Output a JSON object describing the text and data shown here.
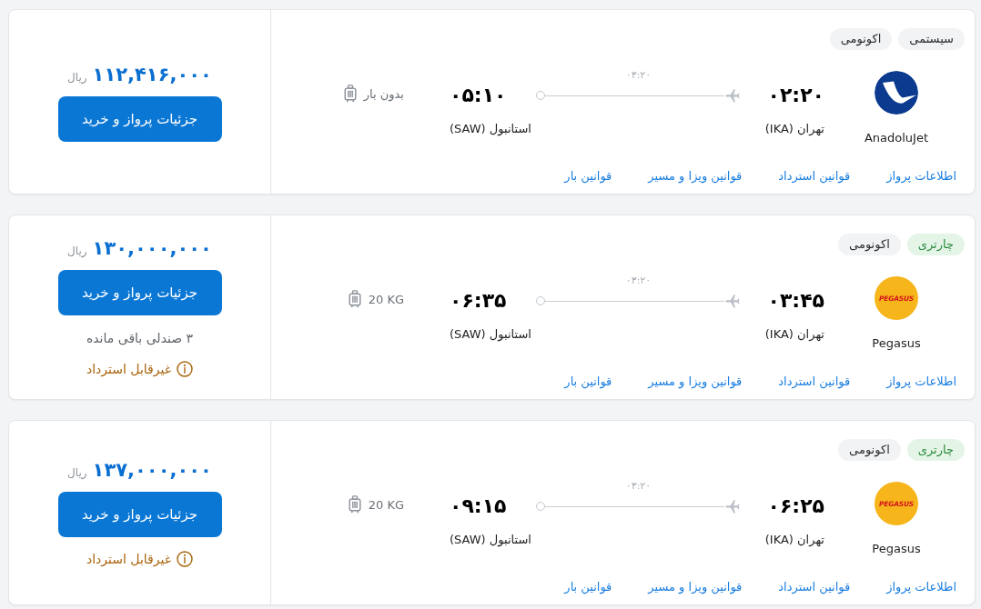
{
  "flights": [
    {
      "tags": [
        {
          "kind": "system",
          "label": "سیستمی"
        },
        {
          "kind": "class",
          "label": "اکونومی"
        }
      ],
      "airline": {
        "logo": {
          "kind": "swoosh"
        },
        "name": "AnadoluJet"
      },
      "departure": {
        "time": "۰۲:۲۰",
        "airport": "تهران (IKA)"
      },
      "duration": "۰۳:۲۰",
      "arrival": {
        "time": "۰۵:۱۰",
        "airport": "استانبول (SAW)"
      },
      "baggage": "بدون بار",
      "links": [
        "اطلاعات پرواز",
        "قوانین استرداد",
        "قوانین ویزا و مسیر",
        "قوانین بار"
      ],
      "price": {
        "amount": "۱۱۲,۴۱۶,۰۰۰",
        "currency": "ریال"
      },
      "button": "جزئیات پرواز و خرید"
    },
    {
      "tags": [
        {
          "kind": "charter",
          "label": "چارتری"
        },
        {
          "kind": "class",
          "label": "اکونومی"
        }
      ],
      "airline": {
        "logo": {
          "kind": "wordmark",
          "text": "PEGASUS"
        },
        "name": "Pegasus"
      },
      "departure": {
        "time": "۰۳:۴۵",
        "airport": "تهران (IKA)"
      },
      "duration": "۰۳:۲۰",
      "arrival": {
        "time": "۰۶:۳۵",
        "airport": "استانبول (SAW)"
      },
      "baggage": "20 KG",
      "links": [
        "اطلاعات پرواز",
        "قوانین استرداد",
        "قوانین ویزا و مسیر",
        "قوانین بار"
      ],
      "price": {
        "amount": "۱۳۰,۰۰۰,۰۰۰",
        "currency": "ریال"
      },
      "button": "جزئیات پرواز و خرید",
      "seats_left": "۳ صندلی باقی مانده",
      "refund_note": "غیرقابل استرداد"
    },
    {
      "tags": [
        {
          "kind": "charter",
          "label": "چارتری"
        },
        {
          "kind": "class",
          "label": "اکونومی"
        }
      ],
      "airline": {
        "logo": {
          "kind": "wordmark",
          "text": "PEGASUS"
        },
        "name": "Pegasus"
      },
      "departure": {
        "time": "۰۶:۲۵",
        "airport": "تهران (IKA)"
      },
      "duration": "۰۳:۲۰",
      "arrival": {
        "time": "۰۹:۱۵",
        "airport": "استانبول (SAW)"
      },
      "baggage": "20 KG",
      "links": [
        "اطلاعات پرواز",
        "قوانین استرداد",
        "قوانین ویزا و مسیر",
        "قوانین بار"
      ],
      "price": {
        "amount": "۱۳۷,۰۰۰,۰۰۰",
        "currency": "ریال"
      },
      "button": "جزئیات پرواز و خرید",
      "refund_note": "غیرقابل استرداد"
    }
  ]
}
